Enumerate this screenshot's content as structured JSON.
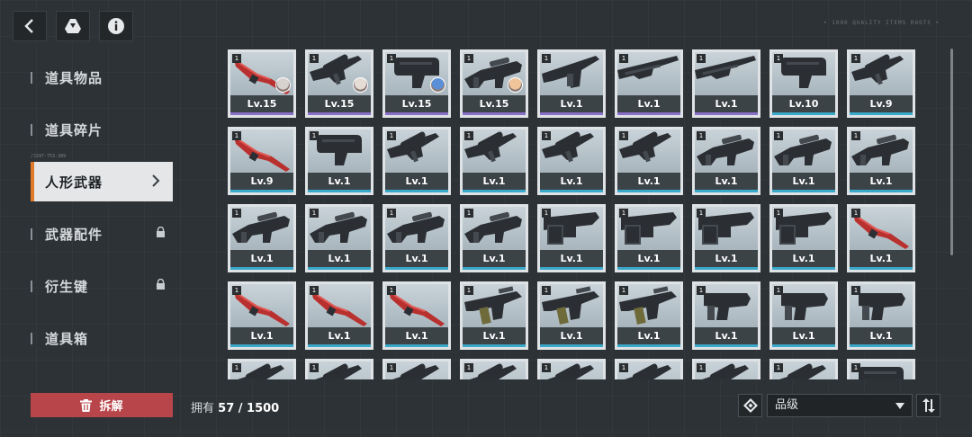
{
  "header": {
    "icons": [
      "back-icon",
      "drive-icon",
      "info-icon"
    ],
    "deco_code": "• 1000 QUALITY ITEMS ROOTS •"
  },
  "sidebar": {
    "code_text": "/J247-753-389",
    "items": [
      {
        "label": "道具物品",
        "locked": false,
        "active": false
      },
      {
        "label": "道具碎片",
        "locked": false,
        "active": false
      },
      {
        "label": "人形武器",
        "locked": false,
        "active": true
      },
      {
        "label": "武器配件",
        "locked": true,
        "active": false
      },
      {
        "label": "衍生键",
        "locked": true,
        "active": false
      },
      {
        "label": "道具箱",
        "locked": false,
        "active": false
      }
    ]
  },
  "colors": {
    "rarity_purple": "#8a6fc9",
    "rarity_blue": "#3aa8c9",
    "active_accent": "#e07a2a",
    "dismantle_red": "#b8454a"
  },
  "weapons": [
    [
      {
        "qty": "1",
        "level": "Lv.15",
        "kind": "red-blade",
        "rarity": "purple",
        "portrait": "#d8d2cf"
      },
      {
        "qty": "1",
        "level": "Lv.15",
        "kind": "sniper",
        "rarity": "purple",
        "portrait": "#e6dcd6"
      },
      {
        "qty": "1",
        "level": "Lv.15",
        "kind": "smg-box",
        "rarity": "purple",
        "portrait": "#5b8fd8"
      },
      {
        "qty": "1",
        "level": "Lv.15",
        "kind": "rifle-scope",
        "rarity": "purple",
        "portrait": "#f0c59a"
      },
      {
        "qty": "1",
        "level": "Lv.1",
        "kind": "carbine",
        "rarity": "purple"
      },
      {
        "qty": "1",
        "level": "Lv.1",
        "kind": "shotgun",
        "rarity": "purple"
      },
      {
        "qty": "1",
        "level": "Lv.1",
        "kind": "shotgun",
        "rarity": "purple"
      },
      {
        "qty": "1",
        "level": "Lv.10",
        "kind": "smg-box",
        "rarity": "blue"
      },
      {
        "qty": "1",
        "level": "Lv.9",
        "kind": "sniper",
        "rarity": "blue"
      }
    ],
    [
      {
        "qty": "1",
        "level": "Lv.9",
        "kind": "red-blade",
        "rarity": "blue"
      },
      {
        "qty": "1",
        "level": "Lv.1",
        "kind": "smg-box",
        "rarity": "blue"
      },
      {
        "qty": "1",
        "level": "Lv.1",
        "kind": "sniper",
        "rarity": "blue"
      },
      {
        "qty": "1",
        "level": "Lv.1",
        "kind": "sniper",
        "rarity": "blue"
      },
      {
        "qty": "1",
        "level": "Lv.1",
        "kind": "sniper",
        "rarity": "blue"
      },
      {
        "qty": "1",
        "level": "Lv.1",
        "kind": "sniper",
        "rarity": "blue"
      },
      {
        "qty": "1",
        "level": "Lv.1",
        "kind": "rifle-scope",
        "rarity": "blue"
      },
      {
        "qty": "1",
        "level": "Lv.1",
        "kind": "rifle-scope",
        "rarity": "blue"
      },
      {
        "qty": "1",
        "level": "Lv.1",
        "kind": "rifle-scope",
        "rarity": "blue"
      }
    ],
    [
      {
        "qty": "1",
        "level": "Lv.1",
        "kind": "rifle-scope",
        "rarity": "blue"
      },
      {
        "qty": "1",
        "level": "Lv.1",
        "kind": "rifle-scope",
        "rarity": "blue"
      },
      {
        "qty": "1",
        "level": "Lv.1",
        "kind": "rifle-scope",
        "rarity": "blue"
      },
      {
        "qty": "1",
        "level": "Lv.1",
        "kind": "rifle-scope",
        "rarity": "blue"
      },
      {
        "qty": "1",
        "level": "Lv.1",
        "kind": "lmg",
        "rarity": "blue"
      },
      {
        "qty": "1",
        "level": "Lv.1",
        "kind": "lmg",
        "rarity": "blue"
      },
      {
        "qty": "1",
        "level": "Lv.1",
        "kind": "lmg",
        "rarity": "blue"
      },
      {
        "qty": "1",
        "level": "Lv.1",
        "kind": "lmg",
        "rarity": "blue"
      },
      {
        "qty": "1",
        "level": "Lv.1",
        "kind": "red-blade",
        "rarity": "blue"
      }
    ],
    [
      {
        "qty": "1",
        "level": "Lv.1",
        "kind": "red-blade",
        "rarity": "blue"
      },
      {
        "qty": "1",
        "level": "Lv.1",
        "kind": "red-blade",
        "rarity": "blue"
      },
      {
        "qty": "1",
        "level": "Lv.1",
        "kind": "red-blade",
        "rarity": "blue"
      },
      {
        "qty": "1",
        "level": "Lv.1",
        "kind": "tan-rifle",
        "rarity": "blue"
      },
      {
        "qty": "1",
        "level": "Lv.1",
        "kind": "tan-rifle",
        "rarity": "blue"
      },
      {
        "qty": "1",
        "level": "Lv.1",
        "kind": "tan-rifle",
        "rarity": "blue"
      },
      {
        "qty": "1",
        "level": "Lv.1",
        "kind": "compact",
        "rarity": "blue"
      },
      {
        "qty": "1",
        "level": "Lv.1",
        "kind": "compact",
        "rarity": "blue"
      },
      {
        "qty": "1",
        "level": "Lv.1",
        "kind": "compact",
        "rarity": "blue"
      }
    ],
    [
      {
        "qty": "1",
        "level": "",
        "kind": "sniper",
        "rarity": "blue"
      },
      {
        "qty": "1",
        "level": "",
        "kind": "sniper",
        "rarity": "blue"
      },
      {
        "qty": "1",
        "level": "",
        "kind": "sniper",
        "rarity": "blue"
      },
      {
        "qty": "1",
        "level": "",
        "kind": "sniper",
        "rarity": "blue"
      },
      {
        "qty": "1",
        "level": "",
        "kind": "sniper",
        "rarity": "blue"
      },
      {
        "qty": "1",
        "level": "",
        "kind": "sniper",
        "rarity": "blue"
      },
      {
        "qty": "1",
        "level": "",
        "kind": "sniper",
        "rarity": "blue"
      },
      {
        "qty": "1",
        "level": "",
        "kind": "sniper",
        "rarity": "blue"
      },
      {
        "qty": "1",
        "level": "",
        "kind": "smg-box",
        "rarity": "blue"
      }
    ]
  ],
  "footer": {
    "dismantle_label": "拆解",
    "owned_label": "拥有",
    "owned_count": "57 / 1500",
    "sort_label": "品级"
  }
}
